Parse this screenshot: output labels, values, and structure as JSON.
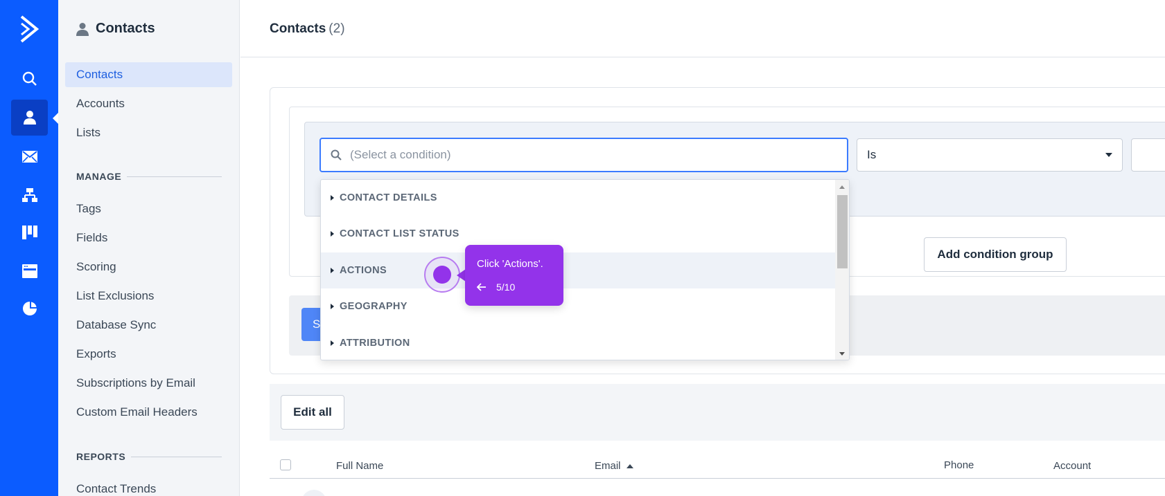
{
  "rail": {
    "accent": "#0b5cff",
    "items": [
      "search-icon",
      "contacts-icon",
      "campaigns-icon",
      "automations-icon",
      "deals-icon",
      "website-icon",
      "reports-icon"
    ]
  },
  "sidebar": {
    "title": "Contacts",
    "items": [
      {
        "label": "Contacts"
      },
      {
        "label": "Accounts"
      },
      {
        "label": "Lists"
      }
    ],
    "manage_label": "MANAGE",
    "manage_items": [
      {
        "label": "Tags"
      },
      {
        "label": "Fields"
      },
      {
        "label": "Scoring"
      },
      {
        "label": "List Exclusions"
      },
      {
        "label": "Database Sync"
      },
      {
        "label": "Exports"
      },
      {
        "label": "Subscriptions by Email"
      },
      {
        "label": "Custom Email Headers"
      }
    ],
    "reports_label": "REPORTS",
    "reports_items": [
      {
        "label": "Contact Trends"
      }
    ]
  },
  "header": {
    "title": "Contacts",
    "count": "(2)"
  },
  "segment": {
    "condition_placeholder": "(Select a condition)",
    "operator_value": "Is",
    "add_group_label": "Add condition group",
    "save_label": "S"
  },
  "dropdown": {
    "options": [
      {
        "label": "CONTACT DETAILS"
      },
      {
        "label": "CONTACT LIST STATUS"
      },
      {
        "label": "ACTIONS"
      },
      {
        "label": "GEOGRAPHY"
      },
      {
        "label": "ATTRIBUTION"
      }
    ]
  },
  "toolbar": {
    "edit_all_label": "Edit all"
  },
  "table": {
    "columns": [
      "Full Name",
      "Email",
      "Phone",
      "Account"
    ]
  },
  "guide": {
    "text": "Click 'Actions'.",
    "step": "5/10",
    "color": "#9333ea"
  }
}
